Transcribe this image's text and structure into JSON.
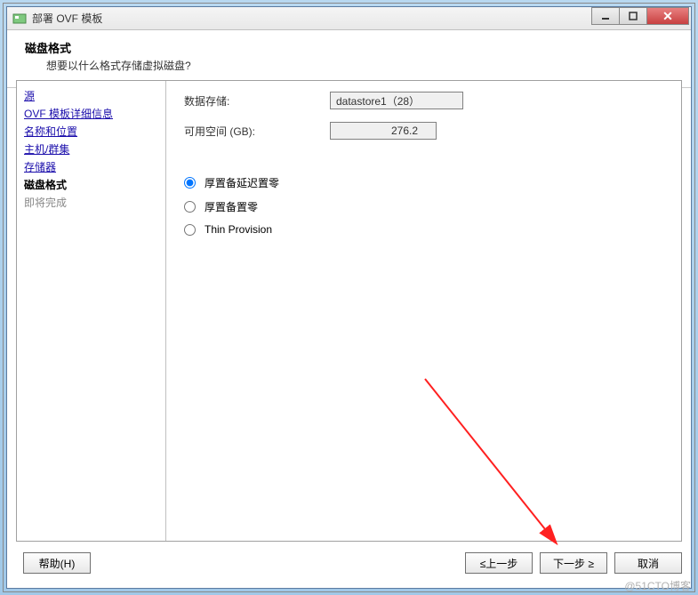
{
  "titlebar": {
    "title": "部署 OVF 模板"
  },
  "header": {
    "title": "磁盘格式",
    "subtitle": "想要以什么格式存储虚拟磁盘?"
  },
  "sidebar": {
    "items": [
      {
        "label": "源"
      },
      {
        "label": "OVF 模板详细信息"
      },
      {
        "label": "名称和位置"
      },
      {
        "label": "主机/群集"
      },
      {
        "label": "存储器"
      }
    ],
    "current": "磁盘格式",
    "upcoming": "即将完成"
  },
  "form": {
    "datastore_label": "数据存储:",
    "datastore_value": "datastore1（28）",
    "freespace_label": "可用空间 (GB):",
    "freespace_value": "276.2"
  },
  "radios": {
    "opt1": "厚置备延迟置零",
    "opt2": "厚置备置零",
    "opt3": "Thin Provision"
  },
  "footer": {
    "help": "帮助(H)",
    "back": "≤上一步",
    "next": "下一步 ≥",
    "cancel": "取消"
  },
  "watermark": "@51CTO博客"
}
